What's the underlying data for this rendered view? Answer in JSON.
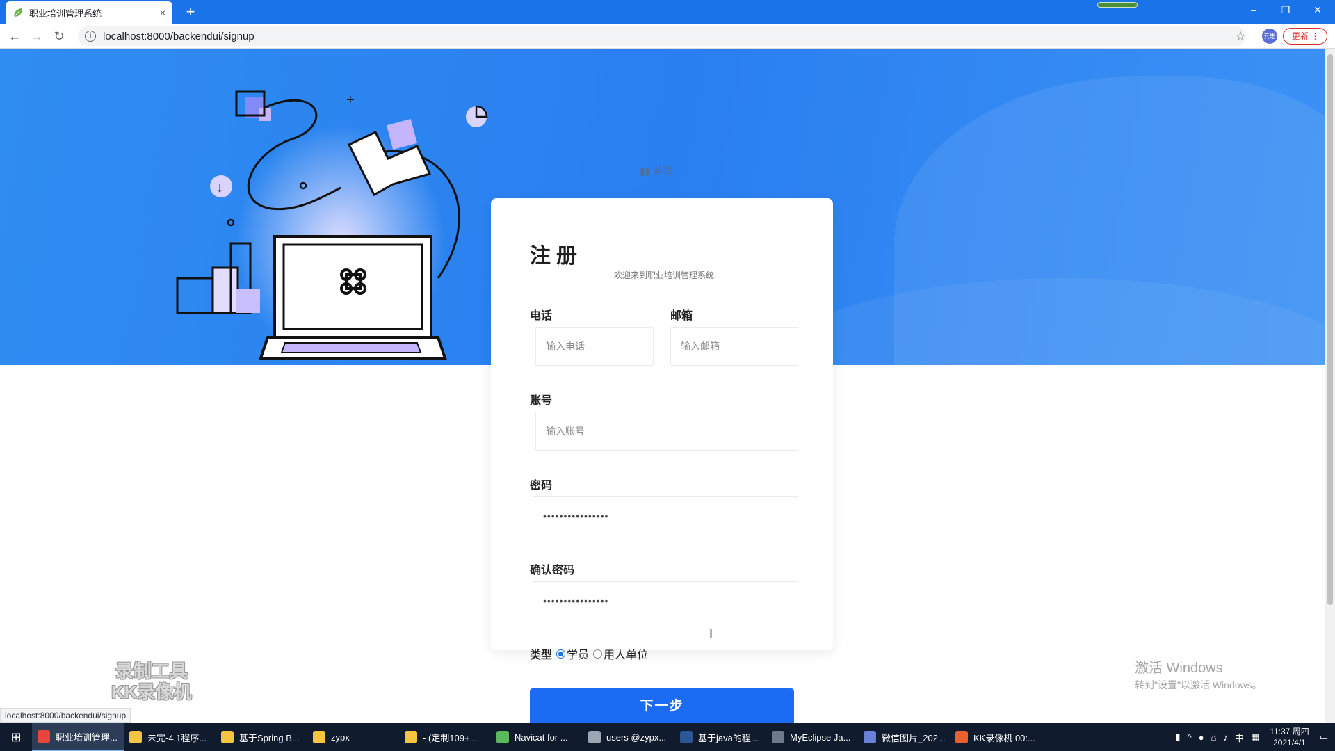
{
  "browser": {
    "tab_title": "职业培训管理系统",
    "tab_close": "×",
    "new_tab": "+",
    "url": "localhost:8000/backendui/signup",
    "update_label": "更新",
    "profile_label": "云思",
    "window_min": "–",
    "window_restore": "❐",
    "window_close": "✕",
    "status_url": "localhost:8000/backendui/signup"
  },
  "hero": {
    "home_link": "首页"
  },
  "form": {
    "title": "注册",
    "subtitle": "欢迎来到职业培训管理系统",
    "phone_label": "电话",
    "phone_placeholder": "输入电话",
    "email_label": "邮箱",
    "email_placeholder": "输入邮箱",
    "account_label": "账号",
    "account_placeholder": "输入账号",
    "password_label": "密码",
    "password_value": "••••••••••••••••",
    "confirm_label": "确认密码",
    "confirm_value": "••••••••••••••••",
    "type_label": "类型",
    "type_options": [
      "学员",
      "用人单位"
    ],
    "type_selected": "学员",
    "next_button": "下一步"
  },
  "overlay": {
    "recorder_line1": "录制工具",
    "recorder_line2": "KK录像机",
    "activate_title": "激活 Windows",
    "activate_sub": "转到\"设置\"以激活 Windows。"
  },
  "taskbar": {
    "items": [
      {
        "label": "职业培训管理...",
        "color": "#e9453b",
        "active": true
      },
      {
        "label": "未完-4.1程序...",
        "color": "#f5c542",
        "active": false
      },
      {
        "label": "基于Spring B...",
        "color": "#f5c542",
        "active": false
      },
      {
        "label": "zypx",
        "color": "#f5c542",
        "active": false
      },
      {
        "label": "- (定制109+...",
        "color": "#f5c542",
        "active": false
      },
      {
        "label": "Navicat for ...",
        "color": "#5cb85c",
        "active": false
      },
      {
        "label": "users @zypx...",
        "color": "#9aa6b2",
        "active": false
      },
      {
        "label": "基于java的程...",
        "color": "#2b5797",
        "active": false
      },
      {
        "label": "MyEclipse Ja...",
        "color": "#6e7b8b",
        "active": false
      },
      {
        "label": "微信图片_202...",
        "color": "#6a7fd6",
        "active": false
      },
      {
        "label": "KK录像机 00:...",
        "color": "#e8612c",
        "active": false
      }
    ],
    "ime": "中",
    "time": "11:37 周四",
    "date": "2021/4/1"
  },
  "colors": {
    "accent": "#1b6cf2",
    "hero": "#2f8cf0",
    "chrome": "#1a73e8"
  }
}
